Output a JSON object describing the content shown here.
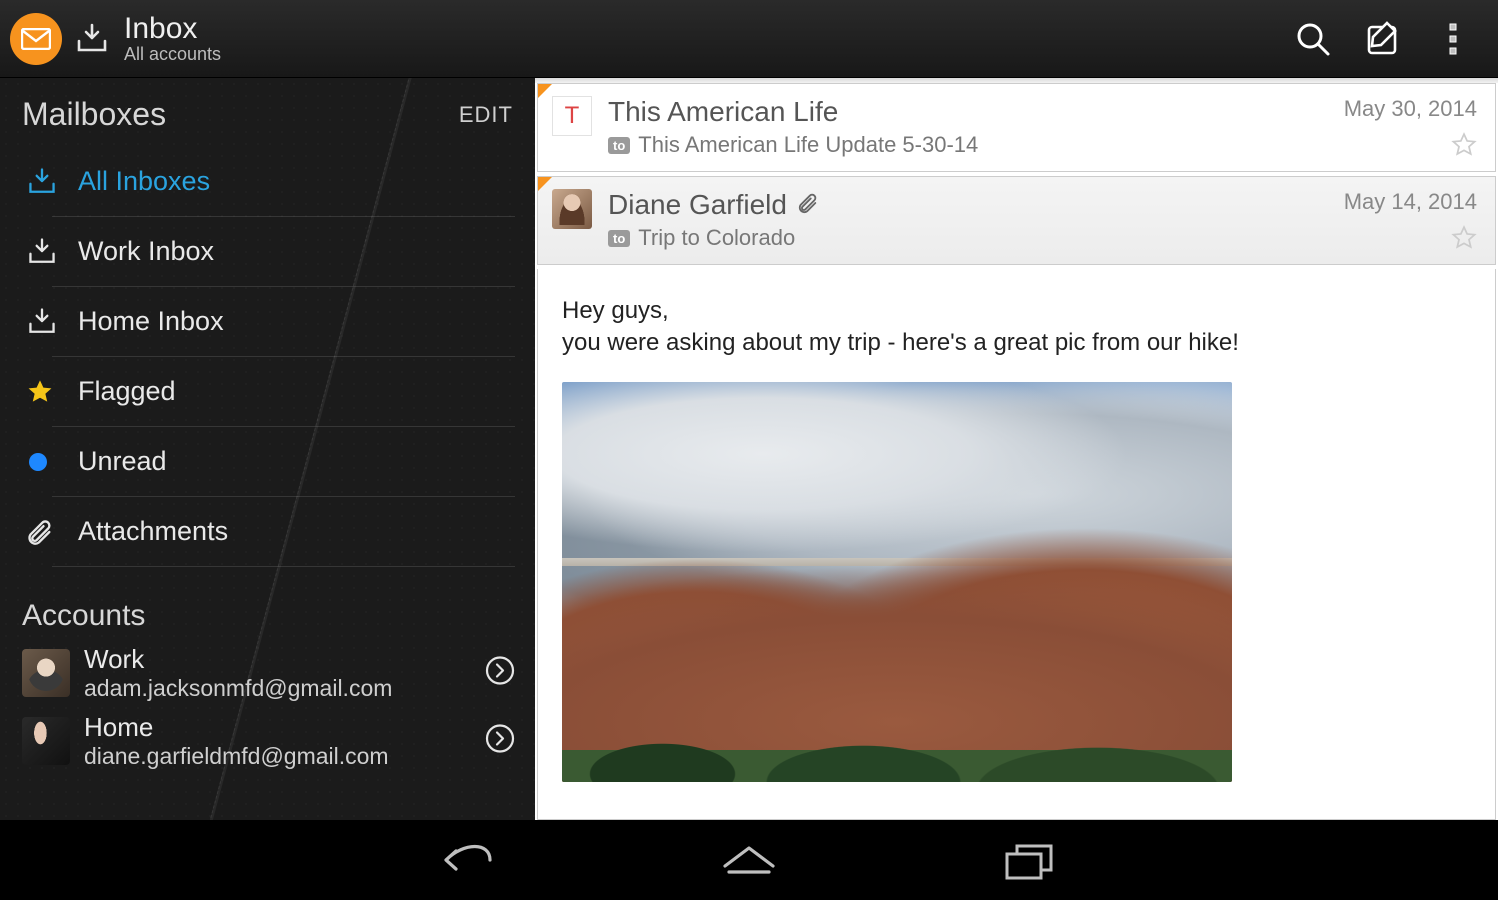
{
  "topbar": {
    "title": "Inbox",
    "subtitle": "All accounts"
  },
  "sidebar": {
    "section_title": "Mailboxes",
    "edit_label": "EDIT",
    "items": [
      {
        "label": "All Inboxes",
        "icon": "inbox-download-icon",
        "active": true
      },
      {
        "label": "Work Inbox",
        "icon": "inbox-download-icon",
        "active": false
      },
      {
        "label": "Home Inbox",
        "icon": "inbox-download-icon",
        "active": false
      },
      {
        "label": "Flagged",
        "icon": "star-icon",
        "active": false
      },
      {
        "label": "Unread",
        "icon": "dot-icon",
        "active": false
      },
      {
        "label": "Attachments",
        "icon": "paperclip-icon",
        "active": false
      }
    ],
    "accounts_title": "Accounts",
    "accounts": [
      {
        "name": "Work",
        "email": "adam.jacksonmfd@gmail.com"
      },
      {
        "name": "Home",
        "email": "diane.garfieldmfd@gmail.com"
      }
    ]
  },
  "messages": [
    {
      "avatar_letter": "T",
      "sender": "This American Life",
      "has_attachment": false,
      "to_badge": "to",
      "subject": "This American Life Update 5-30-14",
      "date": "May 30, 2014",
      "starred": false
    },
    {
      "avatar_letter": "",
      "sender": "Diane Garfield",
      "has_attachment": true,
      "to_badge": "to",
      "subject": "Trip to Colorado",
      "date": "May 14, 2014",
      "starred": false
    }
  ],
  "open_message": {
    "body_line1": "Hey guys,",
    "body_line2": "you were asking about my trip - here's a great pic from our hike!"
  }
}
